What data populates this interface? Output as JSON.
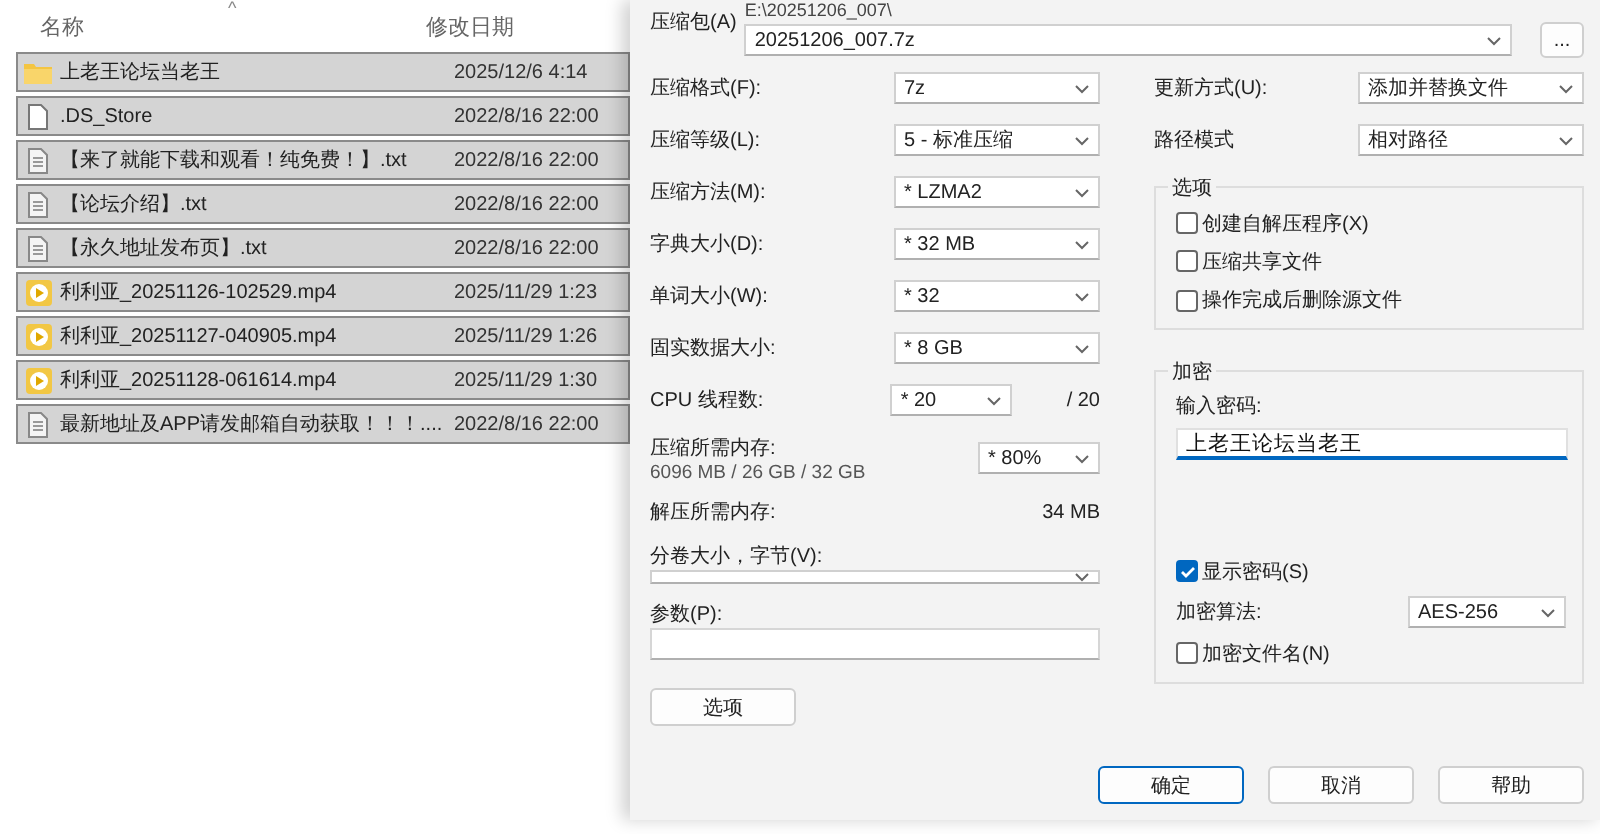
{
  "file_list": {
    "columns": [
      "名称",
      "修改日期"
    ],
    "sort_mark": "^",
    "rows": [
      {
        "kind": "folder",
        "name": "上老王论坛当老王",
        "modified": "2025/12/6 4:14",
        "selected": true
      },
      {
        "kind": "file",
        "name": ".DS_Store",
        "modified": "2022/8/16 22:00",
        "selected": true
      },
      {
        "kind": "text",
        "name": "【来了就能下载和观看！纯免费！】.txt",
        "modified": "2022/8/16 22:00",
        "selected": true
      },
      {
        "kind": "text",
        "name": "【论坛介绍】.txt",
        "modified": "2022/8/16 22:00",
        "selected": true
      },
      {
        "kind": "text",
        "name": "【永久地址发布页】.txt",
        "modified": "2022/8/16 22:00",
        "selected": true
      },
      {
        "kind": "video",
        "name": "利利亚_20251126-102529.mp4",
        "modified": "2025/11/29 1:23",
        "selected": true
      },
      {
        "kind": "video",
        "name": "利利亚_20251127-040905.mp4",
        "modified": "2025/11/29 1:26",
        "selected": true
      },
      {
        "kind": "video",
        "name": "利利亚_20251128-061614.mp4",
        "modified": "2025/11/29 1:30",
        "selected": true
      },
      {
        "kind": "text",
        "name": "最新地址及APP请发邮箱自动获取！！！....",
        "modified": "2022/8/16 22:00",
        "selected": true
      }
    ]
  },
  "dialog": {
    "archive": {
      "label": "压缩包(A)",
      "path": "E:\\20251206_007\\",
      "value": "20251206_007.7z"
    },
    "browse_button": "...",
    "settings": [
      {
        "label": "压缩格式(F):",
        "value": "7z"
      },
      {
        "label": "压缩等级(L):",
        "value": "5 - 标准压缩"
      },
      {
        "label": "压缩方法(M):",
        "value": "*  LZMA2"
      },
      {
        "label": "字典大小(D):",
        "value": "*  32 MB"
      },
      {
        "label": "单词大小(W):",
        "value": "*  32"
      },
      {
        "label": "固实数据大小:",
        "value": "*  8 GB"
      }
    ],
    "threads": {
      "label": "CPU 线程数:",
      "value": "*  20",
      "max": "/ 20"
    },
    "memory": {
      "label": "压缩所需内存:",
      "detail": "6096 MB / 26 GB / 32 GB",
      "value": "*  80%"
    },
    "decompress_memory": {
      "label": "解压所需内存:",
      "value": "34 MB"
    },
    "volume": {
      "label": "分卷大小，字节(V):"
    },
    "parameters": {
      "label": "参数(P):"
    },
    "options_button": "选项",
    "update_mode": {
      "label": "更新方式(U):",
      "value": "添加并替换文件"
    },
    "path_mode": {
      "label": "路径模式",
      "value": "相对路径"
    },
    "options": {
      "title": "选项",
      "checkboxes": [
        {
          "label": "创建自解压程序(X)",
          "checked": false
        },
        {
          "label": "压缩共享文件",
          "checked": false
        },
        {
          "label": "操作完成后删除源文件",
          "checked": false
        }
      ]
    },
    "encryption": {
      "title": "加密",
      "password_label": "输入密码:",
      "password": "上老王论坛当老王",
      "show_password": {
        "label": "显示密码(S)",
        "checked": true
      },
      "method_label": "加密算法:",
      "method": "AES-256",
      "encrypt_names": {
        "label": "加密文件名(N)",
        "checked": false
      }
    },
    "buttons": [
      {
        "label": "确定",
        "focused": true
      },
      {
        "label": "取消",
        "focused": false
      },
      {
        "label": "帮助",
        "focused": false
      }
    ]
  }
}
